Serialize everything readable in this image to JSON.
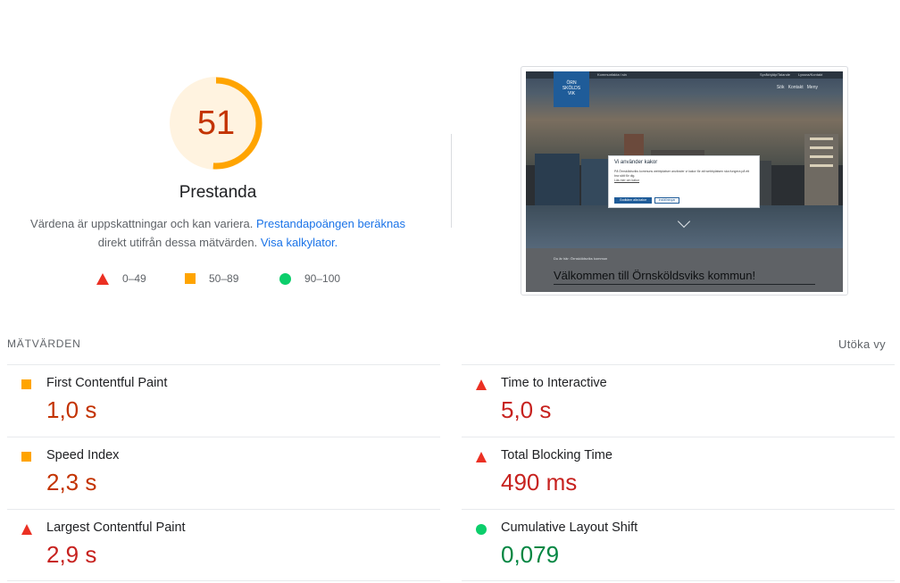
{
  "summary": {
    "score": "51",
    "score_fraction": 0.51,
    "title": "Prestanda",
    "description_text": "Värdena är uppskattningar och kan variera.",
    "description_link": "Prestandapoängen beräknas",
    "description_text2": "direkt utifrån dessa mätvärden.",
    "calculator_link": "Visa kalkylator.",
    "colors": {
      "average": "#ffa400",
      "fail": "#eb3023",
      "pass": "#0cce6b",
      "score_text": "#c33300"
    }
  },
  "legend": [
    {
      "range": "0–49",
      "icon": "triangle-fail-icon"
    },
    {
      "range": "50–89",
      "icon": "square-average-icon"
    },
    {
      "range": "90–100",
      "icon": "circle-pass-icon"
    }
  ],
  "screenshot": {
    "topbar_left": "Kommunfakta i sin",
    "topbar_right1": "Språkhjälp/Talande",
    "topbar_right2": "Lyssna/Kontakt",
    "logo_line1": "ÖRN",
    "logo_line2": "SKÖLDS",
    "logo_line3": "VIK",
    "nav_search": "Sök",
    "nav_contact": "Kontakt",
    "nav_menu": "Meny",
    "modal_title": "Vi använder kakor",
    "modal_text": "På Örnsköldsviks kommuns webbplatser använder vi kakor för att webbplatsen ska fungera på ett bra sätt för dig.",
    "modal_link": "Läs mer om kakor",
    "modal_accept": "Godkänn alla kakor",
    "modal_settings": "Inställningar",
    "crumb": "Du är här:  Örnsköldsviks kommun",
    "heading": "Välkommen till Örnsköldsviks kommun!"
  },
  "metrics": {
    "header": "MÄTVÄRDEN",
    "expand": "Utöka vy",
    "left": [
      {
        "name": "First Contentful Paint",
        "value": "1,0 s",
        "rating": "average"
      },
      {
        "name": "Speed Index",
        "value": "2,3 s",
        "rating": "average"
      },
      {
        "name": "Largest Contentful Paint",
        "value": "2,9 s",
        "rating": "fail"
      }
    ],
    "right": [
      {
        "name": "Time to Interactive",
        "value": "5,0 s",
        "rating": "fail"
      },
      {
        "name": "Total Blocking Time",
        "value": "490 ms",
        "rating": "fail"
      },
      {
        "name": "Cumulative Layout Shift",
        "value": "0,079",
        "rating": "pass"
      }
    ]
  }
}
